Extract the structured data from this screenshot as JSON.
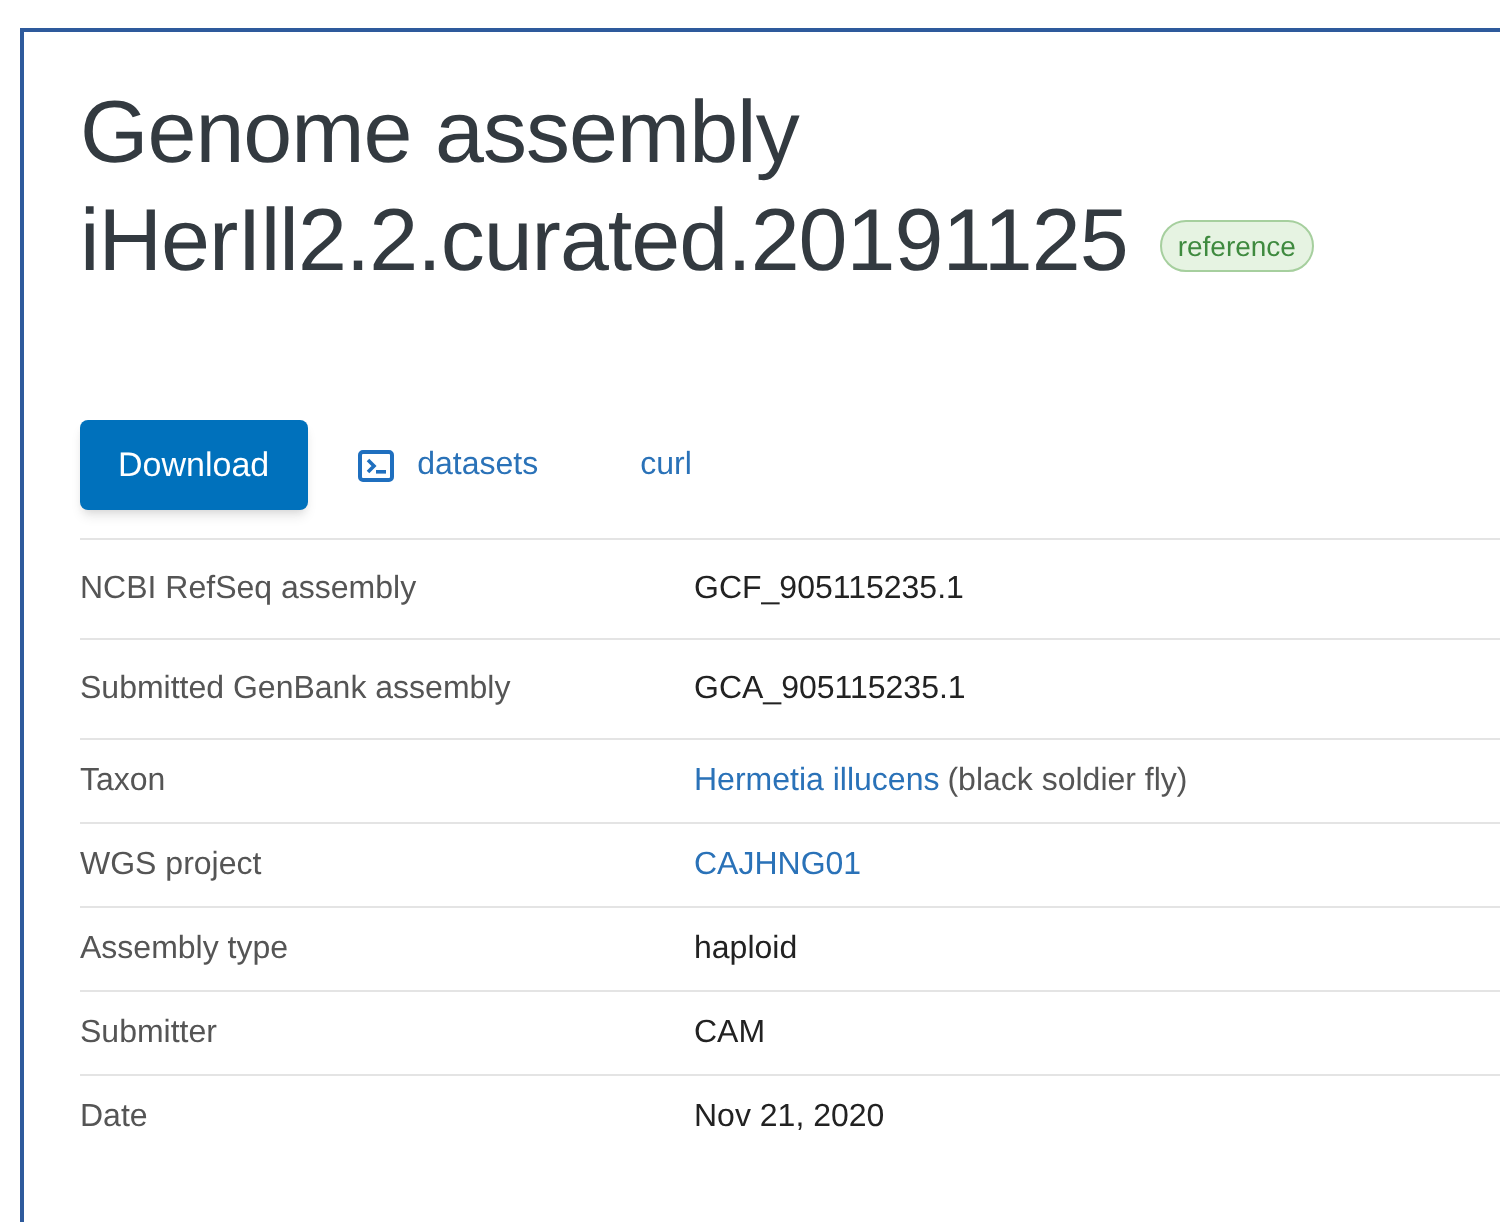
{
  "title": {
    "line_1": "Genome assembly",
    "line_2": "iHerIll2.2.curated.20191125",
    "badge": "reference"
  },
  "actions": [
    {
      "kind": "primary",
      "label": "Download"
    },
    {
      "kind": "terminal",
      "label": "datasets"
    },
    {
      "kind": "link",
      "label": "curl"
    }
  ],
  "details": [
    {
      "label": "NCBI RefSeq assembly",
      "value": "GCF_905115235.1",
      "link": false
    },
    {
      "label": "Submitted GenBank assembly",
      "value": "GCA_905115235.1",
      "link": false
    },
    {
      "label": "Taxon",
      "value": "Hermetia illucens",
      "link": true,
      "note": "(black soldier fly)"
    },
    {
      "label": "WGS project",
      "value": "CAJHNG01",
      "link": true
    },
    {
      "label": "Assembly type",
      "value": "haploid",
      "link": false
    },
    {
      "label": "Submitter",
      "value": "CAM",
      "link": false
    },
    {
      "label": "Date",
      "value": "Nov 21, 2020",
      "link": false
    }
  ]
}
